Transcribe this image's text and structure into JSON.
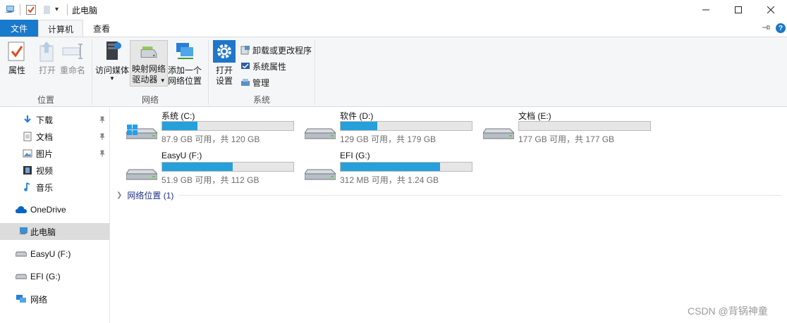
{
  "window": {
    "title": "此电脑",
    "quick_access": {
      "dropdown": "▾"
    },
    "controls": {
      "minimize": "—",
      "maximize": "☐",
      "close": "✕"
    }
  },
  "tabs": {
    "file": "文件",
    "computer": "计算机",
    "view": "查看",
    "help": "?"
  },
  "ribbon": {
    "location": {
      "label": "位置",
      "properties": "属性",
      "open": "打开",
      "rename": "重命名"
    },
    "network": {
      "label": "网络",
      "access_media": "访问媒体",
      "map_drive_line1": "映射网络",
      "map_drive_line2": "驱动器",
      "add_location_line1": "添加一个",
      "add_location_line2": "网络位置"
    },
    "system": {
      "label": "系统",
      "open_settings_line1": "打开",
      "open_settings_line2": "设置",
      "uninstall": "卸载或更改程序",
      "system_properties": "系统属性",
      "manage": "管理"
    }
  },
  "nav": {
    "quick_items": [
      {
        "label": "下载",
        "icon": "download-icon"
      },
      {
        "label": "文档",
        "icon": "document-icon"
      },
      {
        "label": "图片",
        "icon": "picture-icon"
      },
      {
        "label": "视频",
        "icon": "video-icon"
      },
      {
        "label": "音乐",
        "icon": "music-icon"
      }
    ],
    "onedrive": "OneDrive",
    "this_pc": "此电脑",
    "drive_f": "EasyU (F:)",
    "drive_g": "EFI (G:)",
    "network": "网络"
  },
  "drives": [
    {
      "name": "系统 (C:)",
      "info": "87.9 GB 可用，共 120 GB",
      "used_fraction": 0.27,
      "windows_logo": true
    },
    {
      "name": "软件 (D:)",
      "info": "129 GB 可用，共 179 GB",
      "used_fraction": 0.28
    },
    {
      "name": "文档 (E:)",
      "info": "177 GB 可用，共 177 GB",
      "used_fraction": 0.0
    },
    {
      "name": "EasyU (F:)",
      "info": "51.9 GB 可用，共 112 GB",
      "used_fraction": 0.54
    },
    {
      "name": "EFI (G:)",
      "info": "312 MB 可用，共 1.24 GB",
      "used_fraction": 0.76
    }
  ],
  "network_locations": "网络位置 (1)",
  "watermark": "CSDN @背锅神童",
  "colors": {
    "accent": "#1979ca",
    "bar_fill": "#26a0da"
  }
}
